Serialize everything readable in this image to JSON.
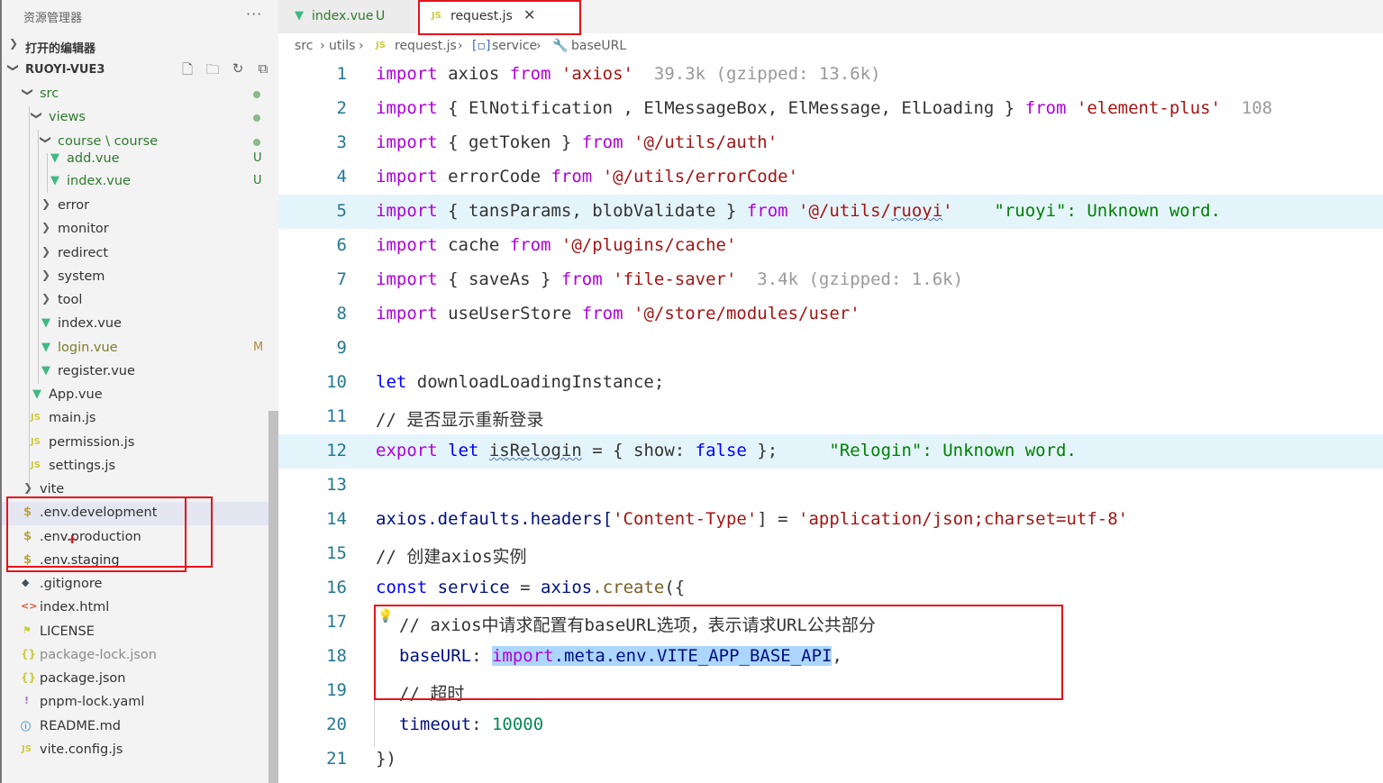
{
  "sidebar": {
    "title": "资源管理器",
    "more": "···",
    "open_editors": "打开的编辑器",
    "project": "RUOYI-VUE3",
    "tree": {
      "src": "src",
      "views": "views",
      "course": "course \\ course",
      "add_vue": "add.vue",
      "index_vue_course": "index.vue",
      "error": "error",
      "monitor": "monitor",
      "redirect": "redirect",
      "system": "system",
      "tool": "tool",
      "index_vue": "index.vue",
      "login_vue": "login.vue",
      "register_vue": "register.vue",
      "app_vue": "App.vue",
      "main_js": "main.js",
      "permission_js": "permission.js",
      "settings_js": "settings.js",
      "vite": "vite",
      "env_development": ".env.development",
      "env_production": ".env.production",
      "env_staging": ".env.staging",
      "gitignore": ".gitignore",
      "index_html": "index.html",
      "license": "LICENSE",
      "package_lock": "package-lock.json",
      "package_json": "package.json",
      "pnpm_lock": "pnpm-lock.yaml",
      "readme": "README.md",
      "vite_config": "vite.config.js"
    },
    "badges": {
      "untracked": "U",
      "modified": "M"
    }
  },
  "tabs": [
    {
      "label": "index.vue",
      "status": "U",
      "icon": "vue-icon"
    },
    {
      "label": "request.js",
      "icon": "js-icon",
      "close": "✕"
    }
  ],
  "breadcrumb": {
    "src": "src",
    "utils": "utils",
    "file": "request.js",
    "service": "service",
    "baseurl": "baseURL"
  },
  "editor": {
    "line_numbers": [
      "1",
      "2",
      "3",
      "4",
      "5",
      "6",
      "7",
      "8",
      "9",
      "10",
      "11",
      "12",
      "13",
      "14",
      "15",
      "16",
      "17",
      "18",
      "19",
      "20",
      "21"
    ],
    "lines": {
      "l1": {
        "a": "import",
        "b": " axios ",
        "c": "from",
        "d": " 'axios'",
        "hint": "  39.3k (gzipped: 13.6k)"
      },
      "l2": {
        "a": "import",
        "b": " { ElNotification , ElMessageBox, ElMessage, ElLoading } ",
        "c": "from",
        "d": " 'element-plus'",
        "hint": "  108"
      },
      "l3": {
        "a": "import",
        "b": " { getToken } ",
        "c": "from",
        "d": " '@/utils/auth'"
      },
      "l4": {
        "a": "import",
        "b": " errorCode ",
        "c": "from",
        "d": " '@/utils/errorCode'"
      },
      "l5": {
        "a": "import",
        "b": " { tansParams, blobValidate } ",
        "c": "from",
        "d": " '@/utils/",
        "e": "ruoyi",
        "f": "'",
        "diag": "    \"ruoyi\": Unknown word."
      },
      "l6": {
        "a": "import",
        "b": " cache ",
        "c": "from",
        "d": " '@/plugins/cache'"
      },
      "l7": {
        "a": "import",
        "b": " { saveAs } ",
        "c": "from",
        "d": " 'file-saver'",
        "hint": "  3.4k (gzipped: 1.6k)"
      },
      "l8": {
        "a": "import",
        "b": " useUserStore ",
        "c": "from",
        "d": " '@/store/modules/user'"
      },
      "l10": {
        "a": "let",
        "b": " downloadLoadingInstance;"
      },
      "l11": {
        "cm": "// 是否显示重新登录"
      },
      "l12": {
        "a": "export",
        "b": " let",
        "c": " ",
        "d": "isRelogin",
        "e": " = { show: ",
        "f": "false",
        "g": " };",
        "diag": "     \"Relogin\": Unknown word."
      },
      "l14": {
        "a": "axios",
        "b": ".defaults.headers[",
        "c": "'Content-Type'",
        "d": "] = ",
        "e": "'application/json;charset=utf-8'"
      },
      "l15": {
        "cm": "// 创建axios实例"
      },
      "l16": {
        "a": "const",
        "b": " service",
        "c": " = ",
        "d": "axios",
        "e": ".create",
        "f": "({"
      },
      "l17": {
        "cm": "// axios中请求配置有baseURL选项，表示请求URL公共部分"
      },
      "l18": {
        "a": "baseURL",
        "b": ": ",
        "c": "import",
        "d": ".meta.env.VITE_APP_BASE_API",
        "e": ","
      },
      "l19": {
        "cm": "// 超时"
      },
      "l20": {
        "a": "timeout",
        "b": ": ",
        "c": "10000"
      },
      "l21": {
        "a": "})"
      }
    }
  },
  "colors": {
    "keyword": "#0000ff",
    "string": "#a31515",
    "comment": "#008000",
    "number": "#098658",
    "annotation": "#e4141b"
  }
}
